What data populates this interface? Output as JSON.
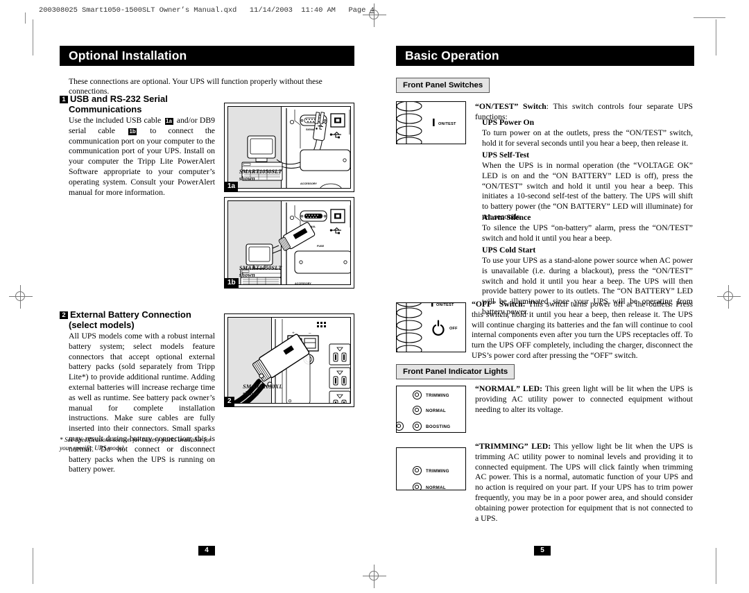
{
  "document": {
    "slug": "200308025 Smart1050-1500SLT Owner’s Manual.qxd   11/14/2003  11:40 AM   Page ",
    "slug_page": "4"
  },
  "left_page": {
    "banner": "Optional Installation",
    "intro": "These connections are optional. Your UPS will function properly without these connections.",
    "section1": {
      "number": "1",
      "title_line1": "USB and RS-232 Serial",
      "title_line2": "Communications",
      "body_pre": "Use the included USB cable ",
      "ref_a": "1a",
      "body_mid": " and/or DB9 serial cable ",
      "ref_b": "1b",
      "body_post": " to connect the communication port on your computer to the communication port of your UPS. Install on your computer the Tripp Lite PowerAlert Software appropriate to your computer’s operating system. Consult your PowerAlert manual for more information."
    },
    "figure_1a": {
      "tag": "1a",
      "caption_line1": "SMART1050SLT",
      "caption_line2": "shown",
      "port_label_signal": "SIGNAL",
      "port_label_accessory": "ACCESSORY"
    },
    "figure_1b": {
      "tag": "1b",
      "caption_line1": "SMART1050SLT",
      "caption_line2": "shown",
      "port_label_signal": "SIGNAL",
      "port_label_fuse": "FUSE",
      "port_label_accessory": "ACCESSORY"
    },
    "section2": {
      "number": "2",
      "title_line1": "External Battery Connection",
      "title_line2": "(select models)",
      "body": "All UPS models come with a robust internal battery system; select models feature connectors that accept optional external battery packs (sold separately from Tripp Lite*) to provide additional runtime. Adding external batteries will increase recharge time as well as runtime. See battery pack owner’s manual for complete installation instructions. Make sure cables are fully inserted into their connectors. Small sparks may result during battery connection; this is normal. Do not connect or disconnect battery packs when the UPS is running on battery power."
    },
    "footnote": "* See Specifications section for battery packs available for your specific UPS model.",
    "figure_2": {
      "tag": "2",
      "caption_line1": "SMART1050XL",
      "caption_line2": "shown",
      "terminal_plus": "+",
      "terminal_minus": "–"
    },
    "page_number": "4"
  },
  "right_page": {
    "banner": "Basic Operation",
    "label_switches": "Front Panel Switches",
    "label_indicators": "Front Panel Indicator Lights",
    "ontest_panel": {
      "switch_label": "ON/TEST"
    },
    "off_panel": {
      "switch_label": "OFF",
      "top_label": "ON/TEST"
    },
    "ontest": {
      "lead_bold": "“ON/TEST” Switch",
      "lead_rest": ": This switch controls four separate UPS functions:",
      "items": [
        {
          "heading": "UPS Power On",
          "body": "To turn power on at the outlets, press the “ON/TEST” switch, hold it for several seconds until you hear a beep, then release it."
        },
        {
          "heading": "UPS Self-Test",
          "body": "When the UPS is in normal operation (the “VOLTAGE OK” LED is on and the “ON BATTERY” LED is off), press the “ON/TEST” switch and hold it until you hear a beep. This initiates a 10-second self-test of the battery. The UPS will shift to battery power (the “ON BATTERY” LED will illuminate) for ten seconds."
        },
        {
          "heading": "Alarm Silence",
          "body": "To silence the UPS “on-battery” alarm, press the “ON/TEST” switch and hold it until you hear a beep."
        },
        {
          "heading": "UPS Cold Start",
          "body": "To use your UPS as a stand-alone power source when AC power is unavailable (i.e. during a blackout), press the “ON/TEST” switch and hold it until you hear a beep. The UPS will then provide battery power to its outlets. The “ON BATTERY” LED will be illuminated since your UPS will be operating from battery power."
        }
      ]
    },
    "off_switch": {
      "lead_bold": "“OFF” Switch:",
      "body": " This switch turns power off at the outlets. Press this switch, hold it until you hear a beep, then release it. The UPS will continue charging its batteries and the fan will continue to cool internal components even after you turn the UPS receptacles off. To turn the UPS OFF completely, including the charger, disconnect the UPS’s power cord after pressing the “OFF” switch."
    },
    "normal_led": {
      "lead_bold": "“NORMAL” LED:",
      "body": " This green light will be lit when the UPS is providing AC utility power to connected equipment without needing to alter its voltage.",
      "panel_labels": [
        "TRIMMING",
        "NORMAL",
        "BOOSTING"
      ]
    },
    "trimming_led": {
      "lead_bold": "“TRIMMING” LED:",
      "body": " This yellow light be lit when the UPS is trimming AC utility power to nominal levels and providing it to connected equipment. The UPS will click faintly when trimming AC power. This is a normal, automatic function of your UPS and no action is required on your part. If your UPS has to trim power frequently, you may be in a poor power area, and should consider obtaining power protection for equipment that is not connected to a UPS.",
      "panel_labels": [
        "TRIMMING",
        "NORMAL"
      ]
    },
    "page_number": "5"
  },
  "colors": {
    "banner_bg": "#000000",
    "banner_fg": "#ffffff",
    "grey_label_bg": "#e4e4e4",
    "figure_panel_grey": "#e2e2e2",
    "mark_grey": "#777777"
  }
}
